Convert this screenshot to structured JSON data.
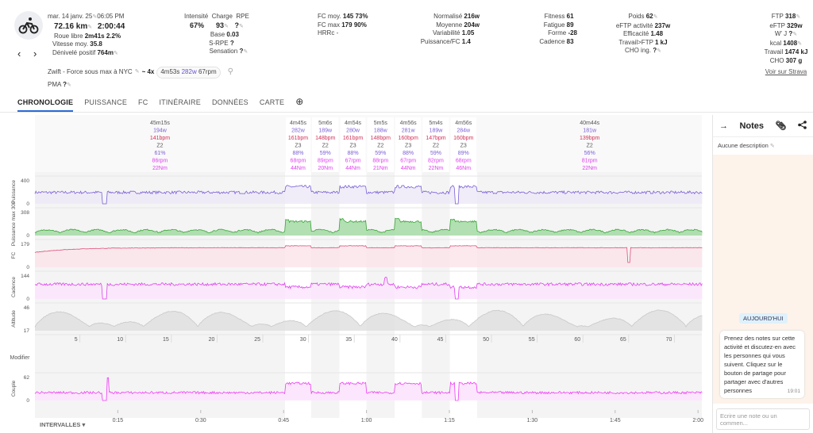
{
  "activity": {
    "date": "mar. 14 janv. 25",
    "time": "06:05 PM",
    "distance": "72.16 km",
    "duration": "2:00:44",
    "roue_libre_label": "Roue libre",
    "roue_libre": "2m41s",
    "roue_libre_pct": "2.2%",
    "vitesse_label": "Vitesse moy.",
    "vitesse": "35.8",
    "denivele_label": "Dénivelé positif",
    "denivele": "764m",
    "workout_name": "Zwift - Force sous max à NYC",
    "workout_summary": {
      "prefix": "~ 4x",
      "dur": "4m53s",
      "power": "282w",
      "cad": "67rpm"
    },
    "pma_label": "PMA",
    "pma": "?"
  },
  "stats": {
    "intensite_label": "Intensité",
    "intensite": "67%",
    "charge_label": "Charge",
    "charge": "93",
    "rpe_label": "RPE",
    "rpe": "?",
    "base_label": "Base",
    "base": "0.03",
    "srpe_label": "S-RPE",
    "srpe": "?",
    "sensation_label": "Sensation",
    "sensation": "?",
    "fc_moy_label": "FC moy.",
    "fc_moy": "145",
    "fc_moy_pct": "73%",
    "fc_max_label": "FC max",
    "fc_max": "179",
    "fc_max_pct": "90%",
    "hrrc_label": "HRRc",
    "hrrc": "-",
    "norm_label": "Normalisé",
    "norm": "216w",
    "moy_label": "Moyenne",
    "moy": "204w",
    "var_label": "Variabilité",
    "var": "1.05",
    "pfc_label": "Puissance/FC",
    "pfc": "1.4",
    "fitness_label": "Fitness",
    "fitness": "61",
    "fatigue_label": "Fatigue",
    "fatigue": "89",
    "forme_label": "Forme",
    "forme": "-28",
    "cadence_label": "Cadence",
    "cadence": "83",
    "poids_label": "Poids",
    "poids": "62",
    "eftp_act_label": "eFTP activité",
    "eftp_act": "237w",
    "eff_label": "Efficacité",
    "eff": "1.48",
    "tftp_label": "Travail>FTP",
    "tftp": "1 kJ",
    "cho_ing_label": "CHO ing.",
    "cho_ing": "?",
    "ftp_label": "FTP",
    "ftp": "318",
    "eftp_label": "eFTP",
    "eftp": "329w",
    "wj_label": "W' J",
    "wj": "?",
    "kcal_label": "kcal",
    "kcal": "1408",
    "travail_label": "Travail",
    "travail": "1474 kJ",
    "cho_label": "CHO",
    "cho": "307 g",
    "strava_link": "Voir sur Strava"
  },
  "tabs": [
    "CHRONOLOGIE",
    "PUISSANCE",
    "FC",
    "ITINÉRAIRE",
    "DONNÉES",
    "CARTE"
  ],
  "intervals": [
    {
      "dur": "45m15s",
      "w": "194w",
      "bpm": "141bpm",
      "zone": "Z2",
      "pct": "61%",
      "rpm": "86rpm",
      "nm": "22Nm"
    },
    {
      "dur": "4m45s",
      "w": "282w",
      "bpm": "161bpm",
      "zone": "Z3",
      "pct": "88%",
      "rpm": "68rpm",
      "nm": "44Nm"
    },
    {
      "dur": "5m6s",
      "w": "189w",
      "bpm": "148bpm",
      "zone": "Z2",
      "pct": "59%",
      "rpm": "89rpm",
      "nm": "20Nm"
    },
    {
      "dur": "4m54s",
      "w": "280w",
      "bpm": "161bpm",
      "zone": "Z3",
      "pct": "88%",
      "rpm": "67rpm",
      "nm": "44Nm"
    },
    {
      "dur": "5m5s",
      "w": "188w",
      "bpm": "148bpm",
      "zone": "Z2",
      "pct": "59%",
      "rpm": "88rpm",
      "nm": "21Nm"
    },
    {
      "dur": "4m56s",
      "w": "281w",
      "bpm": "160bpm",
      "zone": "Z3",
      "pct": "88%",
      "rpm": "67rpm",
      "nm": "44Nm"
    },
    {
      "dur": "5m4s",
      "w": "189w",
      "bpm": "147bpm",
      "zone": "Z2",
      "pct": "59%",
      "rpm": "82rpm",
      "nm": "22Nm"
    },
    {
      "dur": "4m56s",
      "w": "284w",
      "bpm": "160bpm",
      "zone": "Z3",
      "pct": "89%",
      "rpm": "68rpm",
      "nm": "46Nm"
    },
    {
      "dur": "40m44s",
      "w": "181w",
      "bpm": "139bpm",
      "zone": "Z2",
      "pct": "56%",
      "rpm": "81rpm",
      "nm": "22Nm"
    }
  ],
  "charts": [
    {
      "label": "Puissance",
      "max": "400",
      "min": "0",
      "color": "#7b5fd6",
      "fill": "#ece8f8"
    },
    {
      "label": "Puissance max 30s",
      "max": "308",
      "min": "0",
      "color": "#3aa33a",
      "fill": "#9fd89f"
    },
    {
      "label": "FC",
      "max": "179",
      "min": "0",
      "color": "#e0507a",
      "fill": "#fbe3ea"
    },
    {
      "label": "Cadence",
      "max": "144",
      "min": "0",
      "color": "#e040f0",
      "fill": "#fbe4fd"
    },
    {
      "label": "Altitude",
      "max": "46",
      "min": "17",
      "color": "#cfcfcf",
      "fill": "#e2e2e2"
    }
  ],
  "km_ticks": [
    "5",
    "10",
    "15",
    "20",
    "25",
    "30",
    "35",
    "40",
    "45",
    "50",
    "55",
    "60",
    "65",
    "70"
  ],
  "modifier_label": "Modifier",
  "couple": {
    "label": "Couple",
    "max": "62",
    "min": "0",
    "color": "#ee3cf5"
  },
  "time_ticks": [
    "0:15",
    "0:30",
    "0:45",
    "1:00",
    "1:15",
    "1:30",
    "1:45",
    "2:00"
  ],
  "intervalles_label": "INTERVALLES",
  "notes": {
    "title": "Notes",
    "description": "Aucune description",
    "today": "AUJOURD'HUI",
    "message": "Prenez des notes sur cette activité et discutez-en avec les personnes qui vous suivent. Cliquez sur le bouton de partage pour partager avec d'autres personnes",
    "message_time": "19:01",
    "input_placeholder": "Ecrire une note ou un commen..."
  }
}
